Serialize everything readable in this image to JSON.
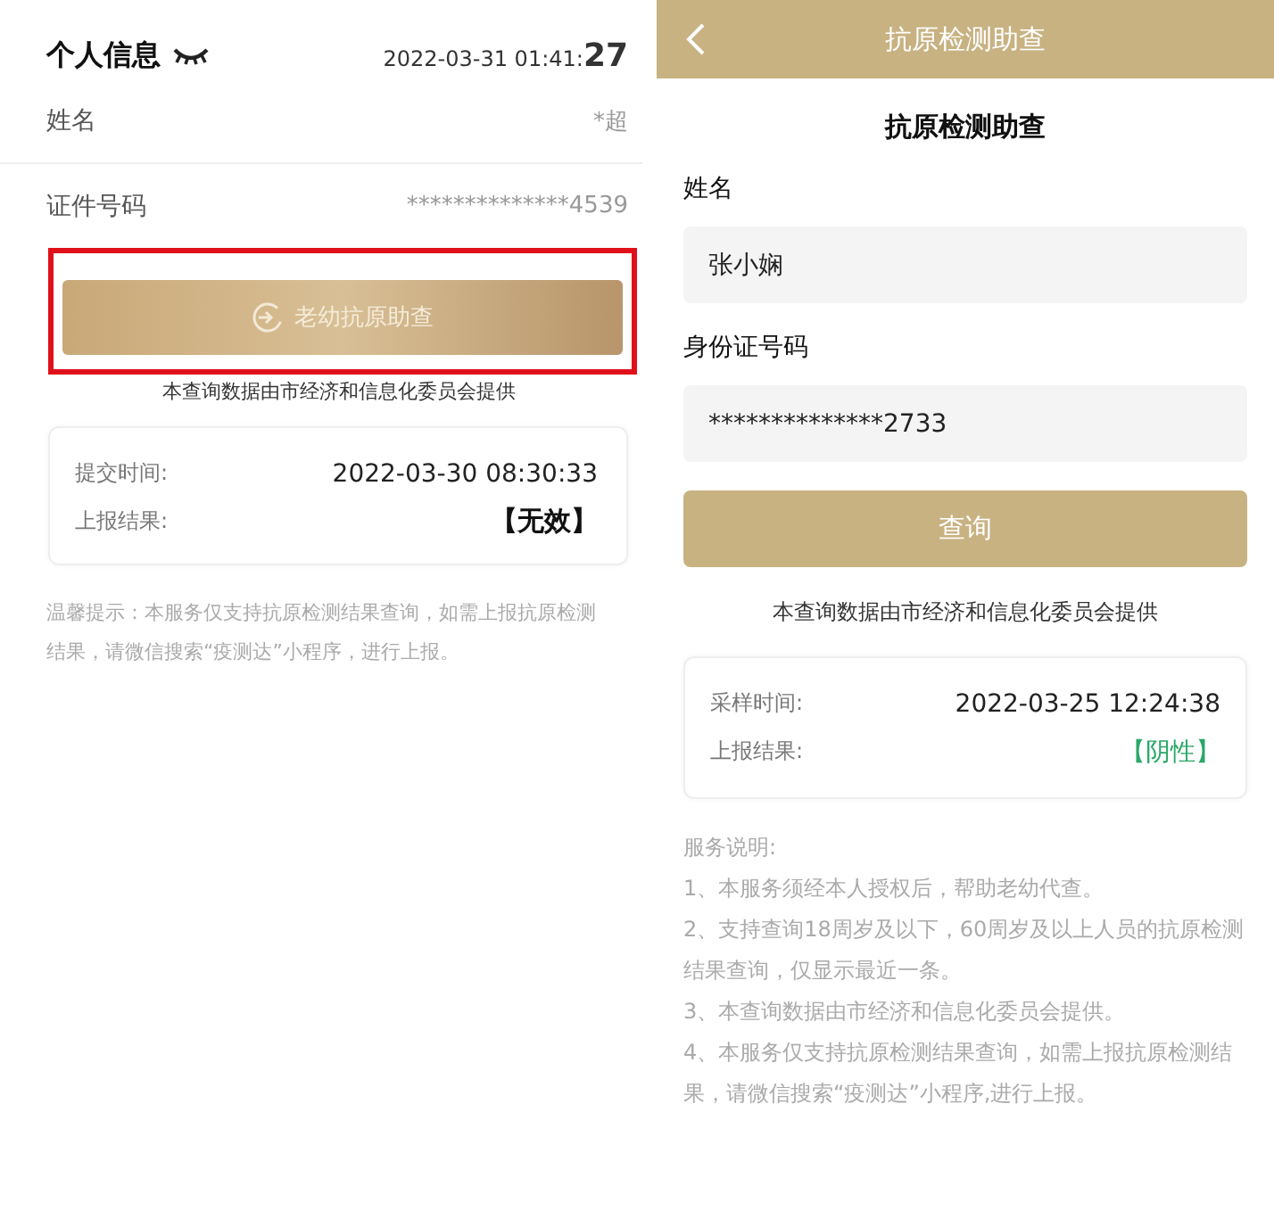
{
  "left_screen": {
    "header": {
      "title": "个人信息",
      "time_main": "2022-03-31 01:41:",
      "time_seconds": "27"
    },
    "rows": [
      {
        "label": "姓名",
        "value": "*超"
      },
      {
        "label": "证件号码",
        "value": "**************4539"
      }
    ],
    "button": {
      "label": "老幼抗原助查",
      "highlighted": true
    },
    "source_note": "本查询数据由市经济和信息化委员会提供",
    "result_card": {
      "rows": [
        {
          "label": "提交时间:",
          "value": "2022-03-30 08:30:33",
          "kind": "time"
        },
        {
          "label": "上报结果:",
          "value": "【无效】",
          "kind": "invalid"
        }
      ]
    },
    "tip": "温馨提示：本服务仅支持抗原检测结果查询，如需上报抗原检测结果，请微信搜索“疫测达”小程序，进行上报。"
  },
  "right_screen": {
    "nav_bar": {
      "title": "抗原检测助查"
    },
    "heading": "抗原检测助查",
    "fields": [
      {
        "label": "姓名",
        "value": "张小娴"
      },
      {
        "label": "身份证号码",
        "value": "**************2733"
      }
    ],
    "button": {
      "label": "查询"
    },
    "source_note": "本查询数据由市经济和信息化委员会提供",
    "result_card": {
      "rows": [
        {
          "label": "采样时间:",
          "value": "2022-03-25 12:24:38",
          "kind": "time"
        },
        {
          "label": "上报结果:",
          "value": "【阴性】",
          "kind": "negative"
        }
      ]
    },
    "service_notes": [
      "服务说明:",
      "1、本服务须经本人授权后，帮助老幼代查。",
      "2、支持查询18周岁及以下，60周岁及以上人员的抗原检测结果查询，仅显示最近一条。",
      "3、本查询数据由市经济和信息化委员会提供。",
      "4、本服务仅支持抗原检测结果查询，如需上报抗原检测结果，请微信搜索“疫测达”小程序,进行上报。"
    ]
  }
}
